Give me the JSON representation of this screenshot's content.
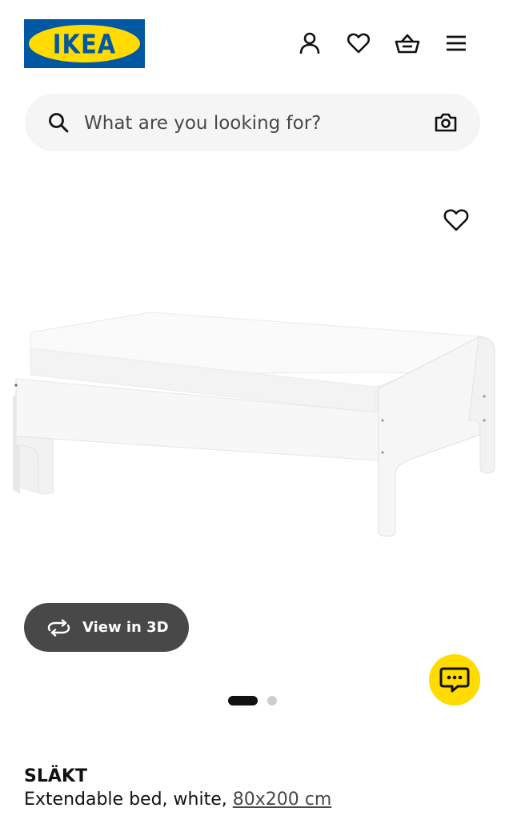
{
  "header": {
    "logo_text": "IKEA",
    "icons": [
      "person-icon",
      "heart-icon",
      "basket-icon",
      "menu-icon"
    ]
  },
  "search": {
    "placeholder": "What are you looking for?",
    "value": ""
  },
  "gallery": {
    "view_3d_label": "View in 3D",
    "slide_count": 2,
    "active_slide": 1
  },
  "product": {
    "name": "SLÄKT",
    "description": "Extendable bed, white,",
    "size": "80x200 cm"
  },
  "colors": {
    "brand_blue": "#0058a3",
    "brand_yellow": "#ffdb00",
    "dark_button": "#484848",
    "search_bg": "#f5f5f5"
  }
}
